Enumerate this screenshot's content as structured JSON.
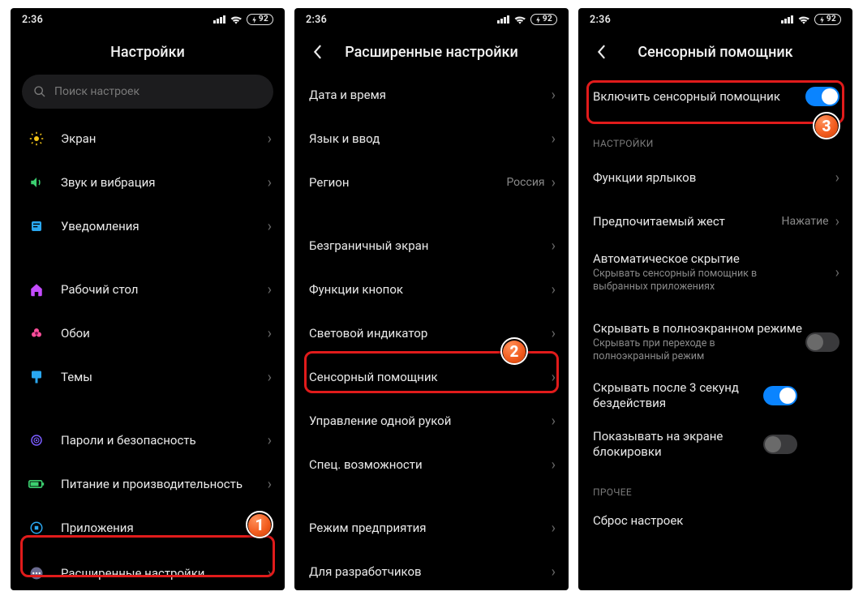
{
  "status": {
    "time": "2:36",
    "battery": "92"
  },
  "colors": {
    "accent": "#0a84ff",
    "highlight": "#e11b1b",
    "badge": "#f25c1f"
  },
  "screen1": {
    "title": "Настройки",
    "search_placeholder": "Поиск настроек",
    "items": [
      {
        "label": "Экран",
        "icon": "sun-icon",
        "color": "#f5c518"
      },
      {
        "label": "Звук и вибрация",
        "icon": "volume-icon",
        "color": "#3cd070"
      },
      {
        "label": "Уведомления",
        "icon": "notifications-icon",
        "color": "#2aa7f0"
      },
      {
        "label": "Рабочий стол",
        "icon": "home-icon",
        "color": "#c44cff"
      },
      {
        "label": "Обои",
        "icon": "flower-icon",
        "color": "#ff4f9a"
      },
      {
        "label": "Темы",
        "icon": "brush-icon",
        "color": "#2aa7f0"
      },
      {
        "label": "Пароли и безопасность",
        "icon": "shield-icon",
        "color": "#7a5cff"
      },
      {
        "label": "Питание и производительность",
        "icon": "battery-icon",
        "color": "#3cd070"
      },
      {
        "label": "Приложения",
        "icon": "apps-icon",
        "color": "#2aa7f0"
      },
      {
        "label": "Расширенные настройки",
        "icon": "more-icon",
        "color": "#8c8cb0"
      }
    ]
  },
  "screen2": {
    "title": "Расширенные настройки",
    "groups": [
      [
        "Дата и время",
        "Язык и ввод"
      ],
      [
        "Безграничный экран",
        "Функции кнопок",
        "Световой индикатор",
        "Сенсорный помощник",
        "Управление одной рукой",
        "Спец. возможности"
      ],
      [
        "Режим предприятия",
        "Для разработчиков"
      ]
    ],
    "region": {
      "label": "Регион",
      "value": "Россия"
    }
  },
  "screen3": {
    "title": "Сенсорный помощник",
    "enable_label": "Включить сенсорный помощник",
    "section_settings": "НАСТРОЙКИ",
    "section_other": "ПРОЧЕЕ",
    "rows": {
      "shortcuts": "Функции ярлыков",
      "gesture": {
        "label": "Предпочитаемый жест",
        "value": "Нажатие"
      },
      "autohide": {
        "label": "Автоматическое скрытие",
        "sub": "Скрывать сенсорный помощник в выбранных приложениях"
      },
      "fullscreen": {
        "label": "Скрывать в полноэкранном режиме",
        "sub": "Скрывать при переходе в полноэкранный режим"
      },
      "idle": "Скрывать после 3 секунд бездействия",
      "lockscreen": "Показывать на экране блокировки",
      "reset": "Сброс настроек"
    }
  }
}
